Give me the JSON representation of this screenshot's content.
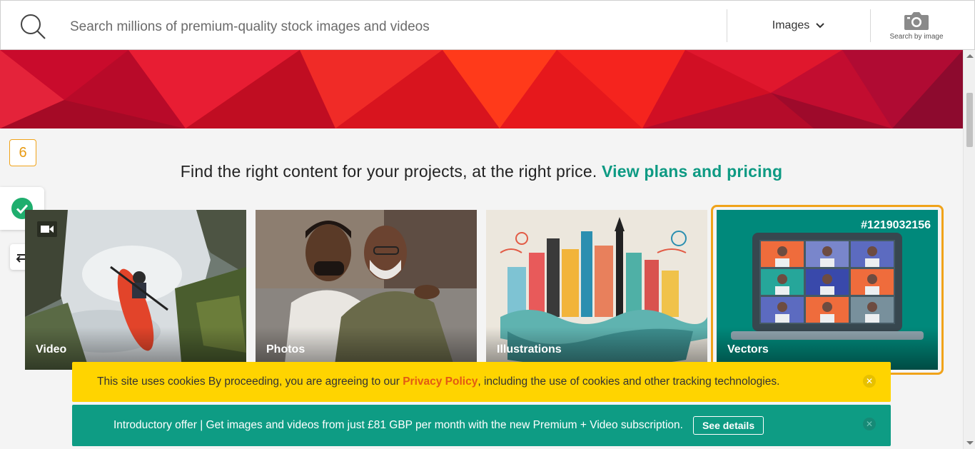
{
  "search": {
    "placeholder": "Search millions of premium-quality stock images and videos",
    "type_label": "Images",
    "search_by_image_label": "Search by image"
  },
  "headline": {
    "text": "Find the right content for your projects, at the right price.",
    "link": "View plans and pricing"
  },
  "sidebar": {
    "counter": "6"
  },
  "cards": [
    {
      "label": "Video"
    },
    {
      "label": "Photos"
    },
    {
      "label": "Illustrations"
    },
    {
      "label": "Vectors",
      "id": "#1219032156"
    }
  ],
  "cookie": {
    "text_before": "This site uses cookies By proceeding, you are agreeing to our ",
    "link": "Privacy Policy",
    "text_after": ", including the use of cookies and other tracking technologies.",
    "close": "✕"
  },
  "offer": {
    "text": "Introductory offer | Get images and videos from just £81 GBP per month with the new Premium + Video subscription.",
    "button": "See details",
    "close": "✕"
  },
  "colors": {
    "accent": "#0e9a83",
    "highlight": "#f0a31a",
    "cookie_bg": "#ffd400",
    "offer_bg": "#0e9c84"
  }
}
